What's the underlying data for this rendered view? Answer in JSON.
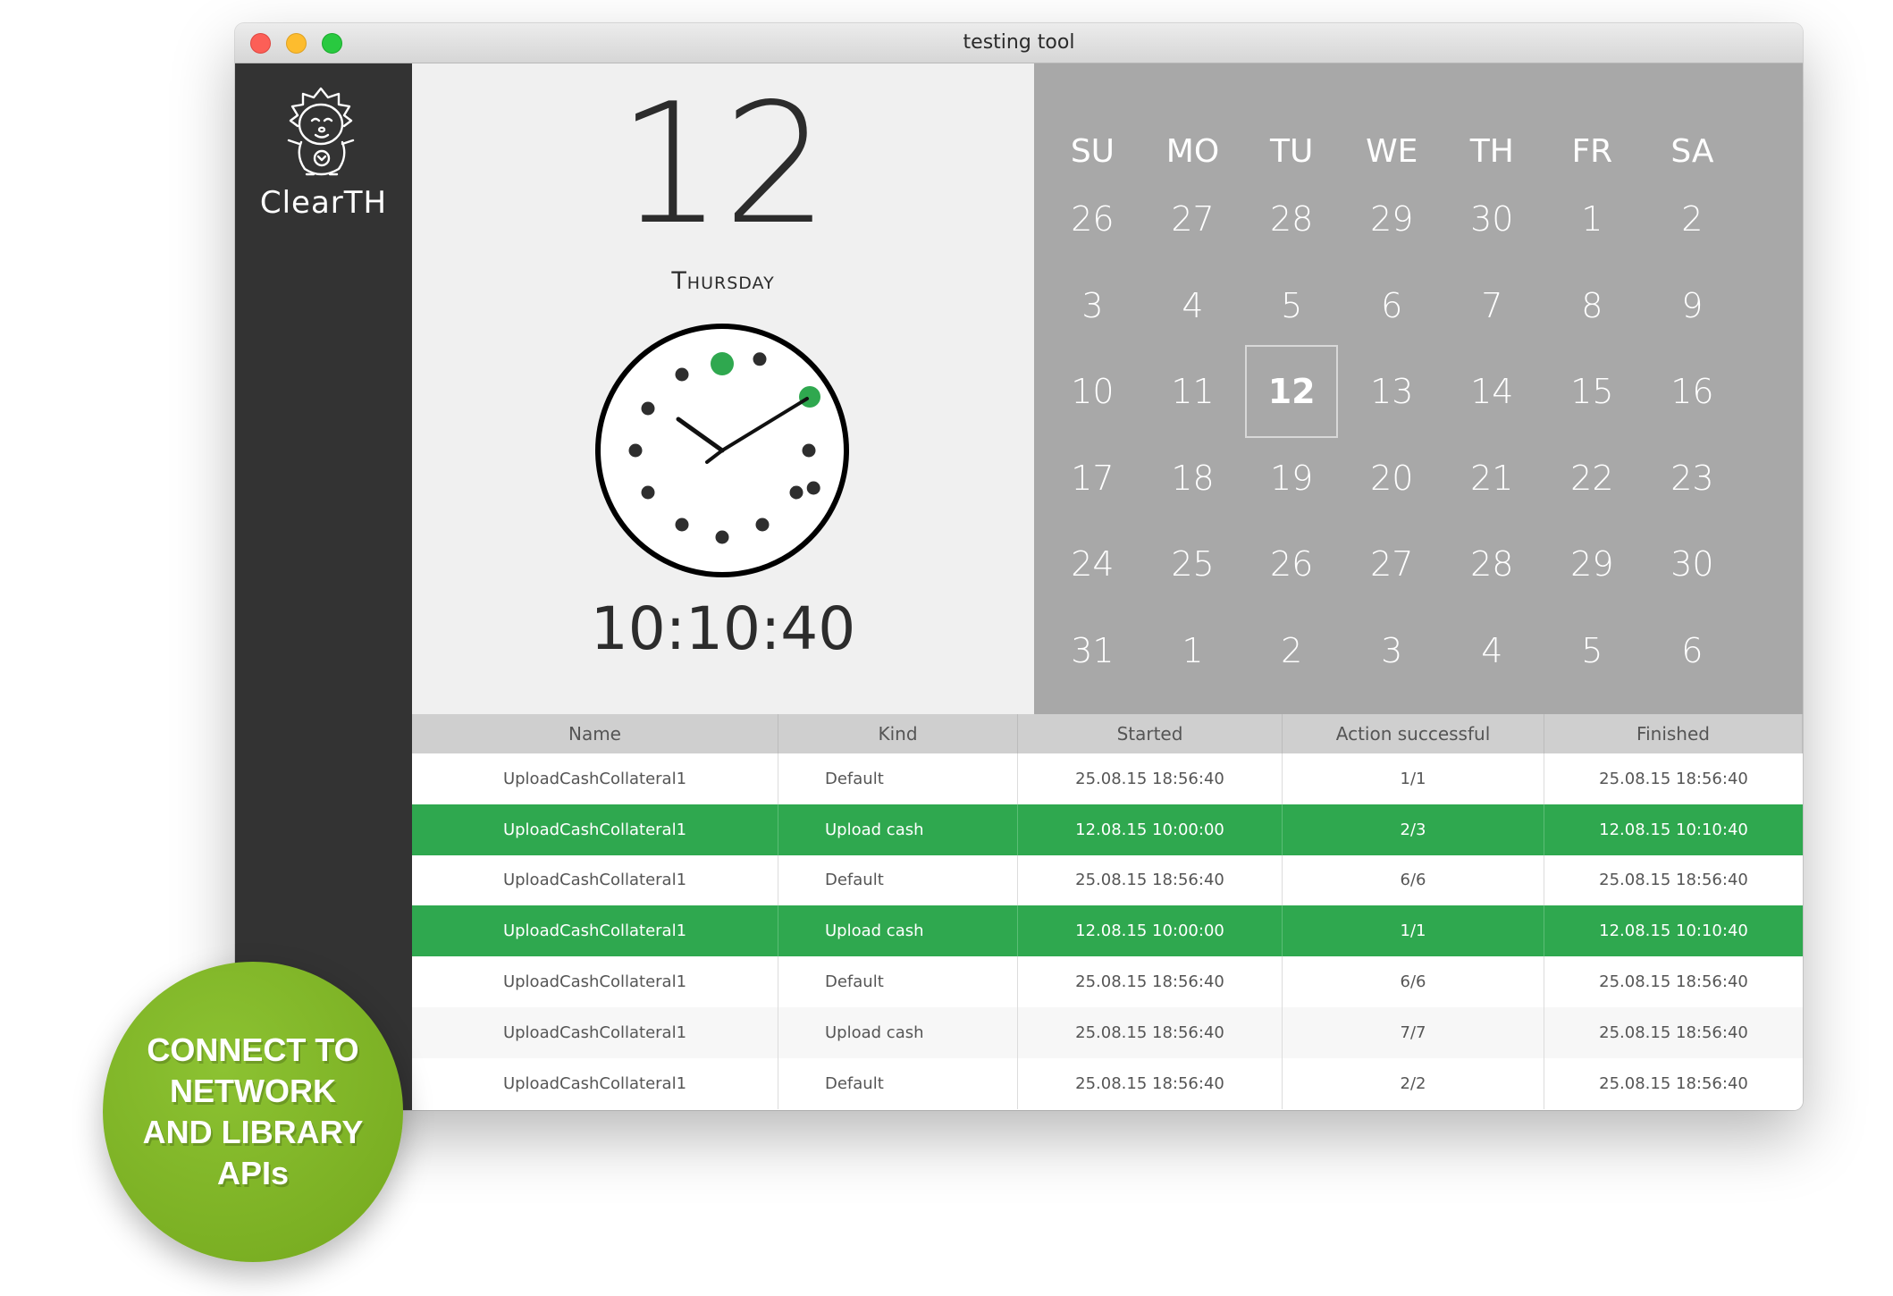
{
  "window": {
    "title": "testing tool"
  },
  "sidebar": {
    "brand": "ClearTH"
  },
  "today": {
    "day": "12",
    "weekday": "Thursday",
    "time": "10:10:40"
  },
  "calendar": {
    "weekdays": [
      "SU",
      "MO",
      "TU",
      "WE",
      "TH",
      "FR",
      "SA"
    ],
    "weeks": [
      [
        "26",
        "27",
        "28",
        "29",
        "30",
        "1",
        "2"
      ],
      [
        "3",
        "4",
        "5",
        "6",
        "7",
        "8",
        "9"
      ],
      [
        "10",
        "11",
        "12",
        "13",
        "14",
        "15",
        "16"
      ],
      [
        "17",
        "18",
        "19",
        "20",
        "21",
        "22",
        "23"
      ],
      [
        "24",
        "25",
        "26",
        "27",
        "28",
        "29",
        "30"
      ],
      [
        "31",
        "1",
        "2",
        "3",
        "4",
        "5",
        "6"
      ]
    ],
    "selected": "12"
  },
  "table": {
    "columns": [
      "Name",
      "Kind",
      "Started",
      "Action successful",
      "Finished"
    ],
    "rows": [
      {
        "name": "UploadCashCollateral1",
        "kind": "Default",
        "started": "25.08.15 18:56:40",
        "success": "1/1",
        "finished": "25.08.15 18:56:40",
        "highlight": false
      },
      {
        "name": "UploadCashCollateral1",
        "kind": "Upload cash",
        "started": "12.08.15 10:00:00",
        "success": "2/3",
        "finished": "12.08.15 10:10:40",
        "highlight": true
      },
      {
        "name": "UploadCashCollateral1",
        "kind": "Default",
        "started": "25.08.15 18:56:40",
        "success": "6/6",
        "finished": "25.08.15 18:56:40",
        "highlight": false
      },
      {
        "name": "UploadCashCollateral1",
        "kind": "Upload cash",
        "started": "12.08.15 10:00:00",
        "success": "1/1",
        "finished": "12.08.15 10:10:40",
        "highlight": true
      },
      {
        "name": "UploadCashCollateral1",
        "kind": "Default",
        "started": "25.08.15 18:56:40",
        "success": "6/6",
        "finished": "25.08.15 18:56:40",
        "highlight": false
      },
      {
        "name": "UploadCashCollateral1",
        "kind": "Upload cash",
        "started": "25.08.15 18:56:40",
        "success": "7/7",
        "finished": "25.08.15 18:56:40",
        "highlight": false
      },
      {
        "name": "UploadCashCollateral1",
        "kind": "Default",
        "started": "25.08.15 18:56:40",
        "success": "2/2",
        "finished": "25.08.15 18:56:40",
        "highlight": false
      }
    ]
  },
  "badge": {
    "text": "CONNECT TO NETWORK AND LIBRARY APIs"
  },
  "colors": {
    "accent": "#2fa84f",
    "sidebar": "#333333",
    "calendar": "#a8a8a8",
    "badge": "#7ab320"
  }
}
